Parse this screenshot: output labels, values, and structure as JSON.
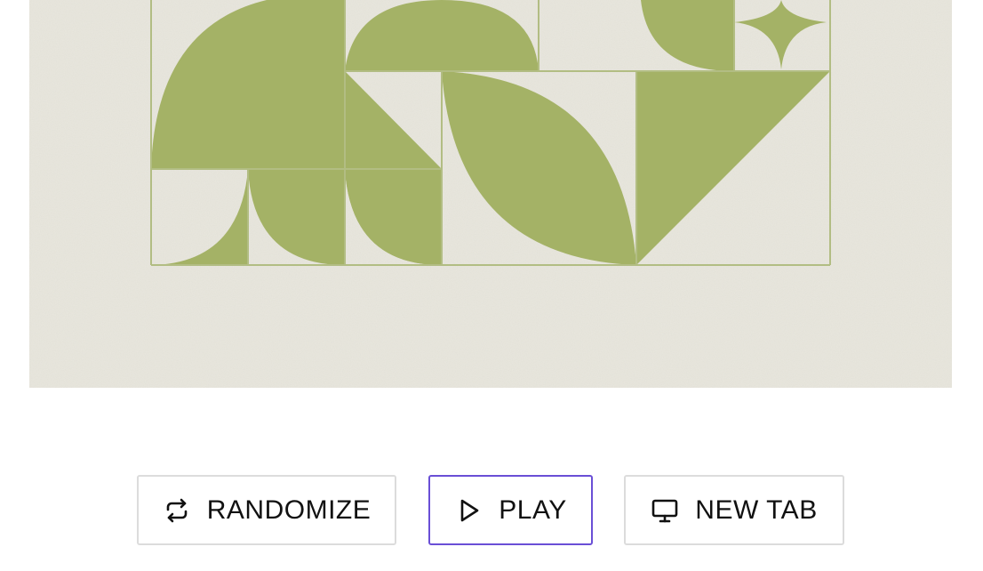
{
  "artwork": {
    "background_color": "#e9e7de",
    "shape_color": "#a4b266",
    "outline_color": "#b2bd83"
  },
  "controls": {
    "randomize": {
      "label": "RANDOMIZE",
      "icon": "repeat-icon"
    },
    "play": {
      "label": "PLAY",
      "icon": "play-icon"
    },
    "new_tab": {
      "label": "NEW TAB",
      "icon": "monitor-icon"
    },
    "focus_color": "#6a4fd6"
  }
}
